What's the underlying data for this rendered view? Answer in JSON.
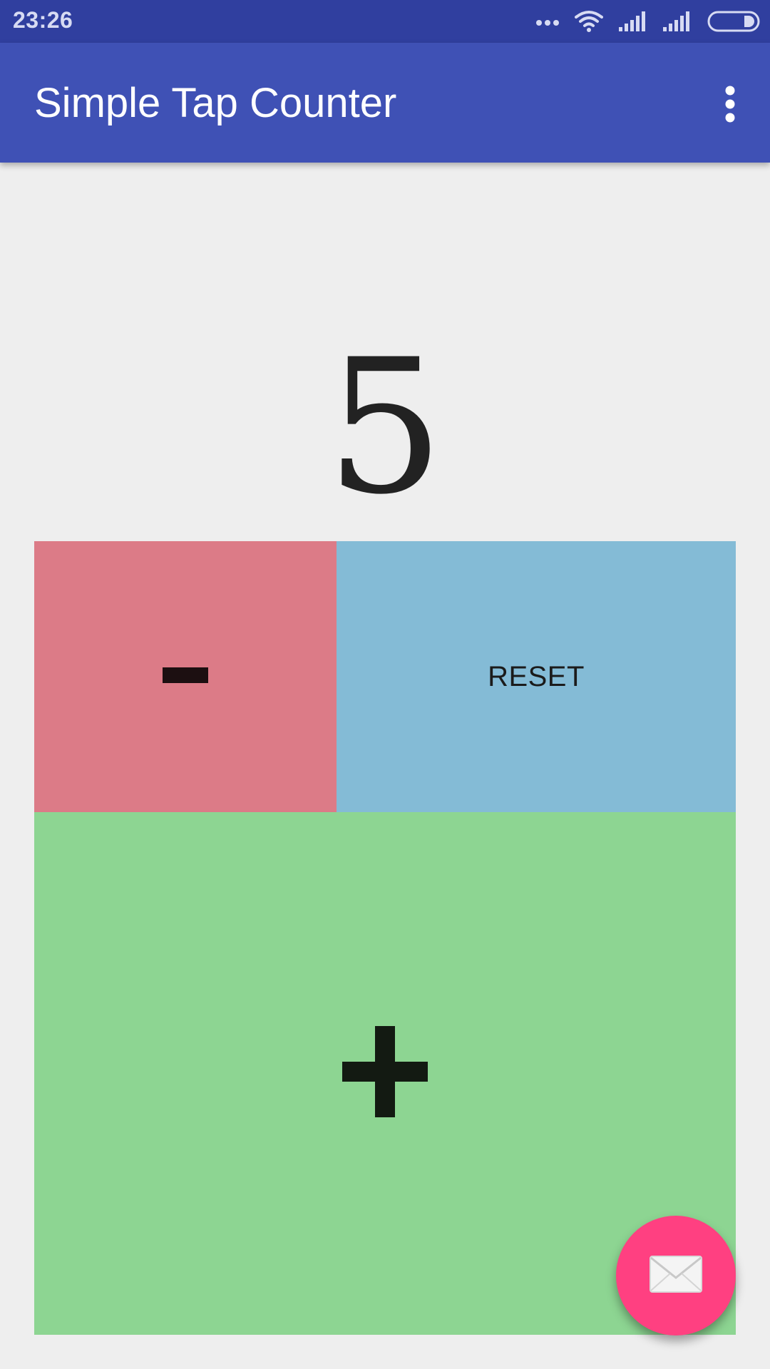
{
  "status_bar": {
    "time": "23:26",
    "icons": [
      "more-dots-icon",
      "wifi-icon",
      "signal-icon",
      "signal-icon",
      "battery-icon"
    ]
  },
  "app_bar": {
    "title": "Simple Tap Counter",
    "menu_icon": "overflow-menu-icon"
  },
  "counter": {
    "value": "5"
  },
  "buttons": {
    "minus_icon": "minus-icon",
    "reset_label": "RESET",
    "plus_icon": "plus-icon"
  },
  "fab": {
    "icon": "mail-icon"
  },
  "colors": {
    "status_bar": "#303f9f",
    "app_bar": "#3f51b5",
    "minus": "#dc7b87",
    "reset": "#84bbd6",
    "plus": "#8dd592",
    "fab": "#ff4081",
    "background": "#eeeeee"
  }
}
